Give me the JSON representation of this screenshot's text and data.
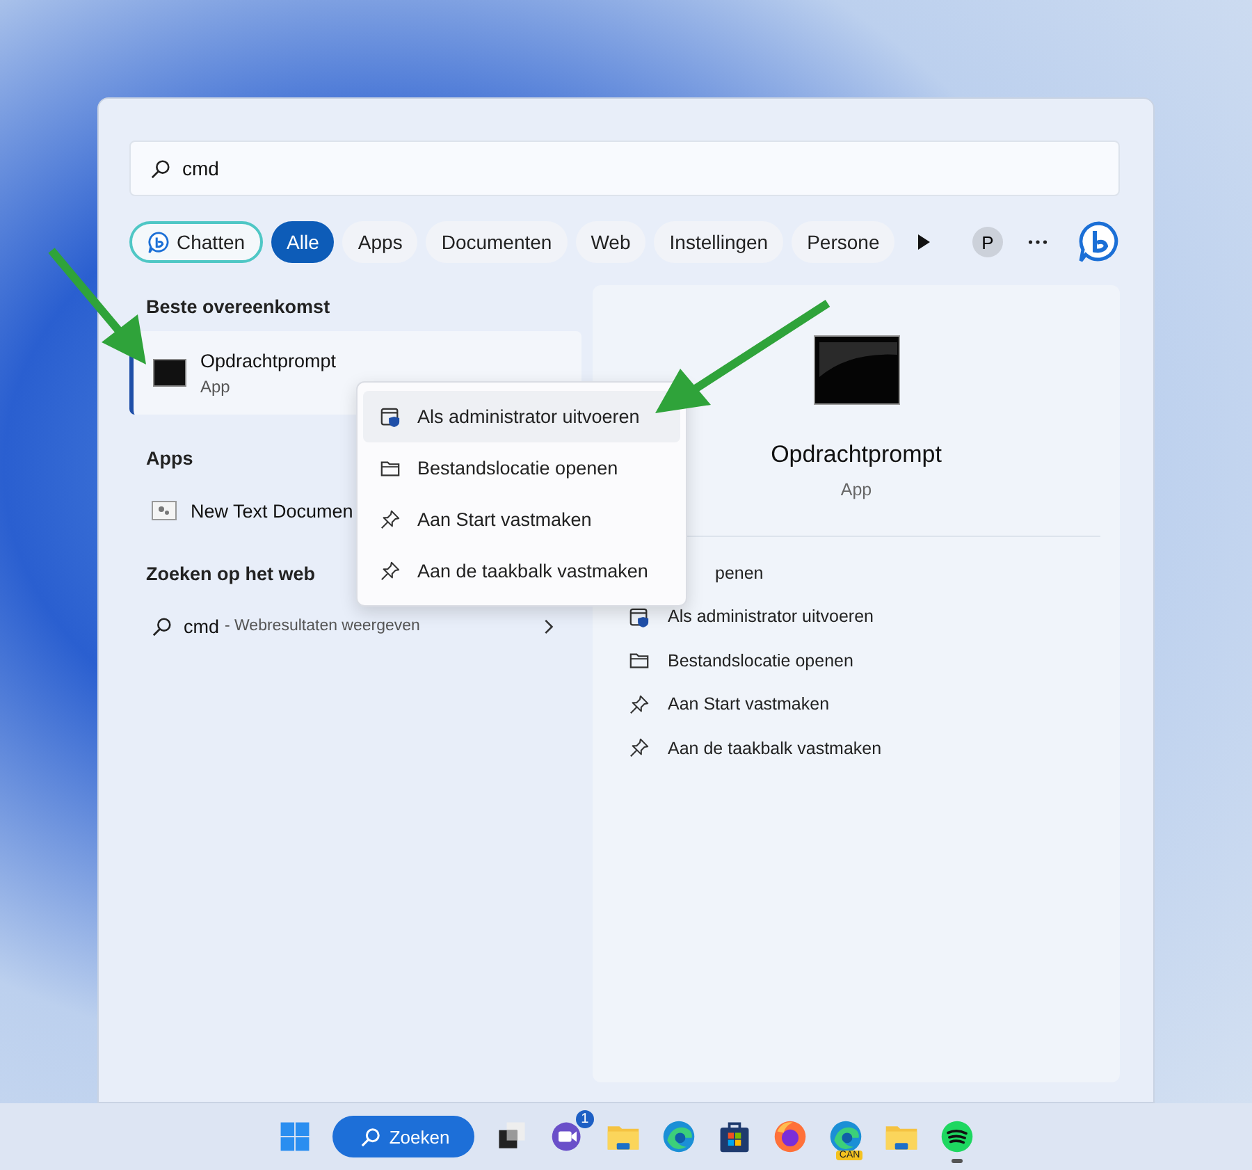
{
  "search": {
    "value": "cmd"
  },
  "filters": [
    {
      "label": "Chatten",
      "kind": "chat",
      "selected": false
    },
    {
      "label": "Alle",
      "kind": "chip",
      "selected": true
    },
    {
      "label": "Apps",
      "kind": "chip",
      "selected": false
    },
    {
      "label": "Documenten",
      "kind": "chip",
      "selected": false
    },
    {
      "label": "Web",
      "kind": "chip",
      "selected": false
    },
    {
      "label": "Instellingen",
      "kind": "chip",
      "selected": false
    },
    {
      "label": "Persone",
      "kind": "chip",
      "selected": false
    }
  ],
  "profile_initial": "P",
  "best_match": {
    "heading": "Beste overeenkomst",
    "title": "Opdrachtprompt",
    "subtitle": "App",
    "selected": true
  },
  "apps": {
    "heading": "Apps",
    "items": [
      {
        "title": "New Text Documen"
      }
    ]
  },
  "web": {
    "heading": "Zoeken op het web",
    "query": "cmd",
    "hint": "- Webresultaten weergeven"
  },
  "detail": {
    "title": "Opdrachtprompt",
    "subtitle": "App",
    "actions": [
      {
        "label": "penen",
        "kind": "open"
      },
      {
        "label": "Als administrator uitvoeren",
        "kind": "admin"
      },
      {
        "label": "Bestandslocatie openen",
        "kind": "folder"
      },
      {
        "label": "Aan Start vastmaken",
        "kind": "pin"
      },
      {
        "label": "Aan de taakbalk vastmaken",
        "kind": "pin"
      }
    ]
  },
  "context_menu": [
    {
      "label": "Als administrator uitvoeren",
      "kind": "admin",
      "selected": true
    },
    {
      "label": "Bestandslocatie openen",
      "kind": "folder",
      "selected": false
    },
    {
      "label": "Aan Start vastmaken",
      "kind": "pin",
      "selected": false
    },
    {
      "label": "Aan de taakbalk vastmaken",
      "kind": "pin",
      "selected": false
    }
  ],
  "taskbar": {
    "search_label": "Zoeken",
    "apps": [
      {
        "kind": "taskview"
      },
      {
        "kind": "chat",
        "badge": "1"
      },
      {
        "kind": "folder"
      },
      {
        "kind": "edge"
      },
      {
        "kind": "store"
      },
      {
        "kind": "firefox"
      },
      {
        "kind": "edge",
        "badge": "CAN"
      },
      {
        "kind": "folder"
      },
      {
        "kind": "spotify",
        "running": true
      }
    ]
  }
}
